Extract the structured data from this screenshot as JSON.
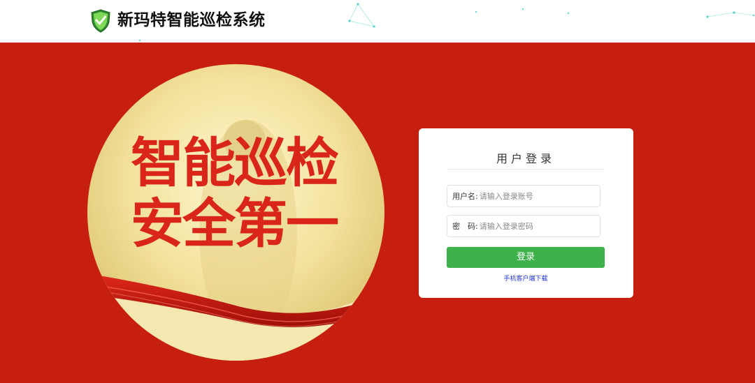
{
  "header": {
    "title": "新玛特智能巡检系统",
    "logo_icon": "shield-check-icon"
  },
  "banner": {
    "line1": "智能巡检",
    "line2": "安全第一"
  },
  "login": {
    "title": "用户登录",
    "username_label": "用户名:",
    "username_placeholder": "请输入登录账号",
    "password_label": "密　码:",
    "password_placeholder": "请输入登录密码",
    "submit_label": "登录",
    "download_link": "手机客户端下载"
  },
  "colors": {
    "background_red": "#c61f10",
    "login_green": "#3db14a",
    "link_blue": "#1a2ee0"
  }
}
